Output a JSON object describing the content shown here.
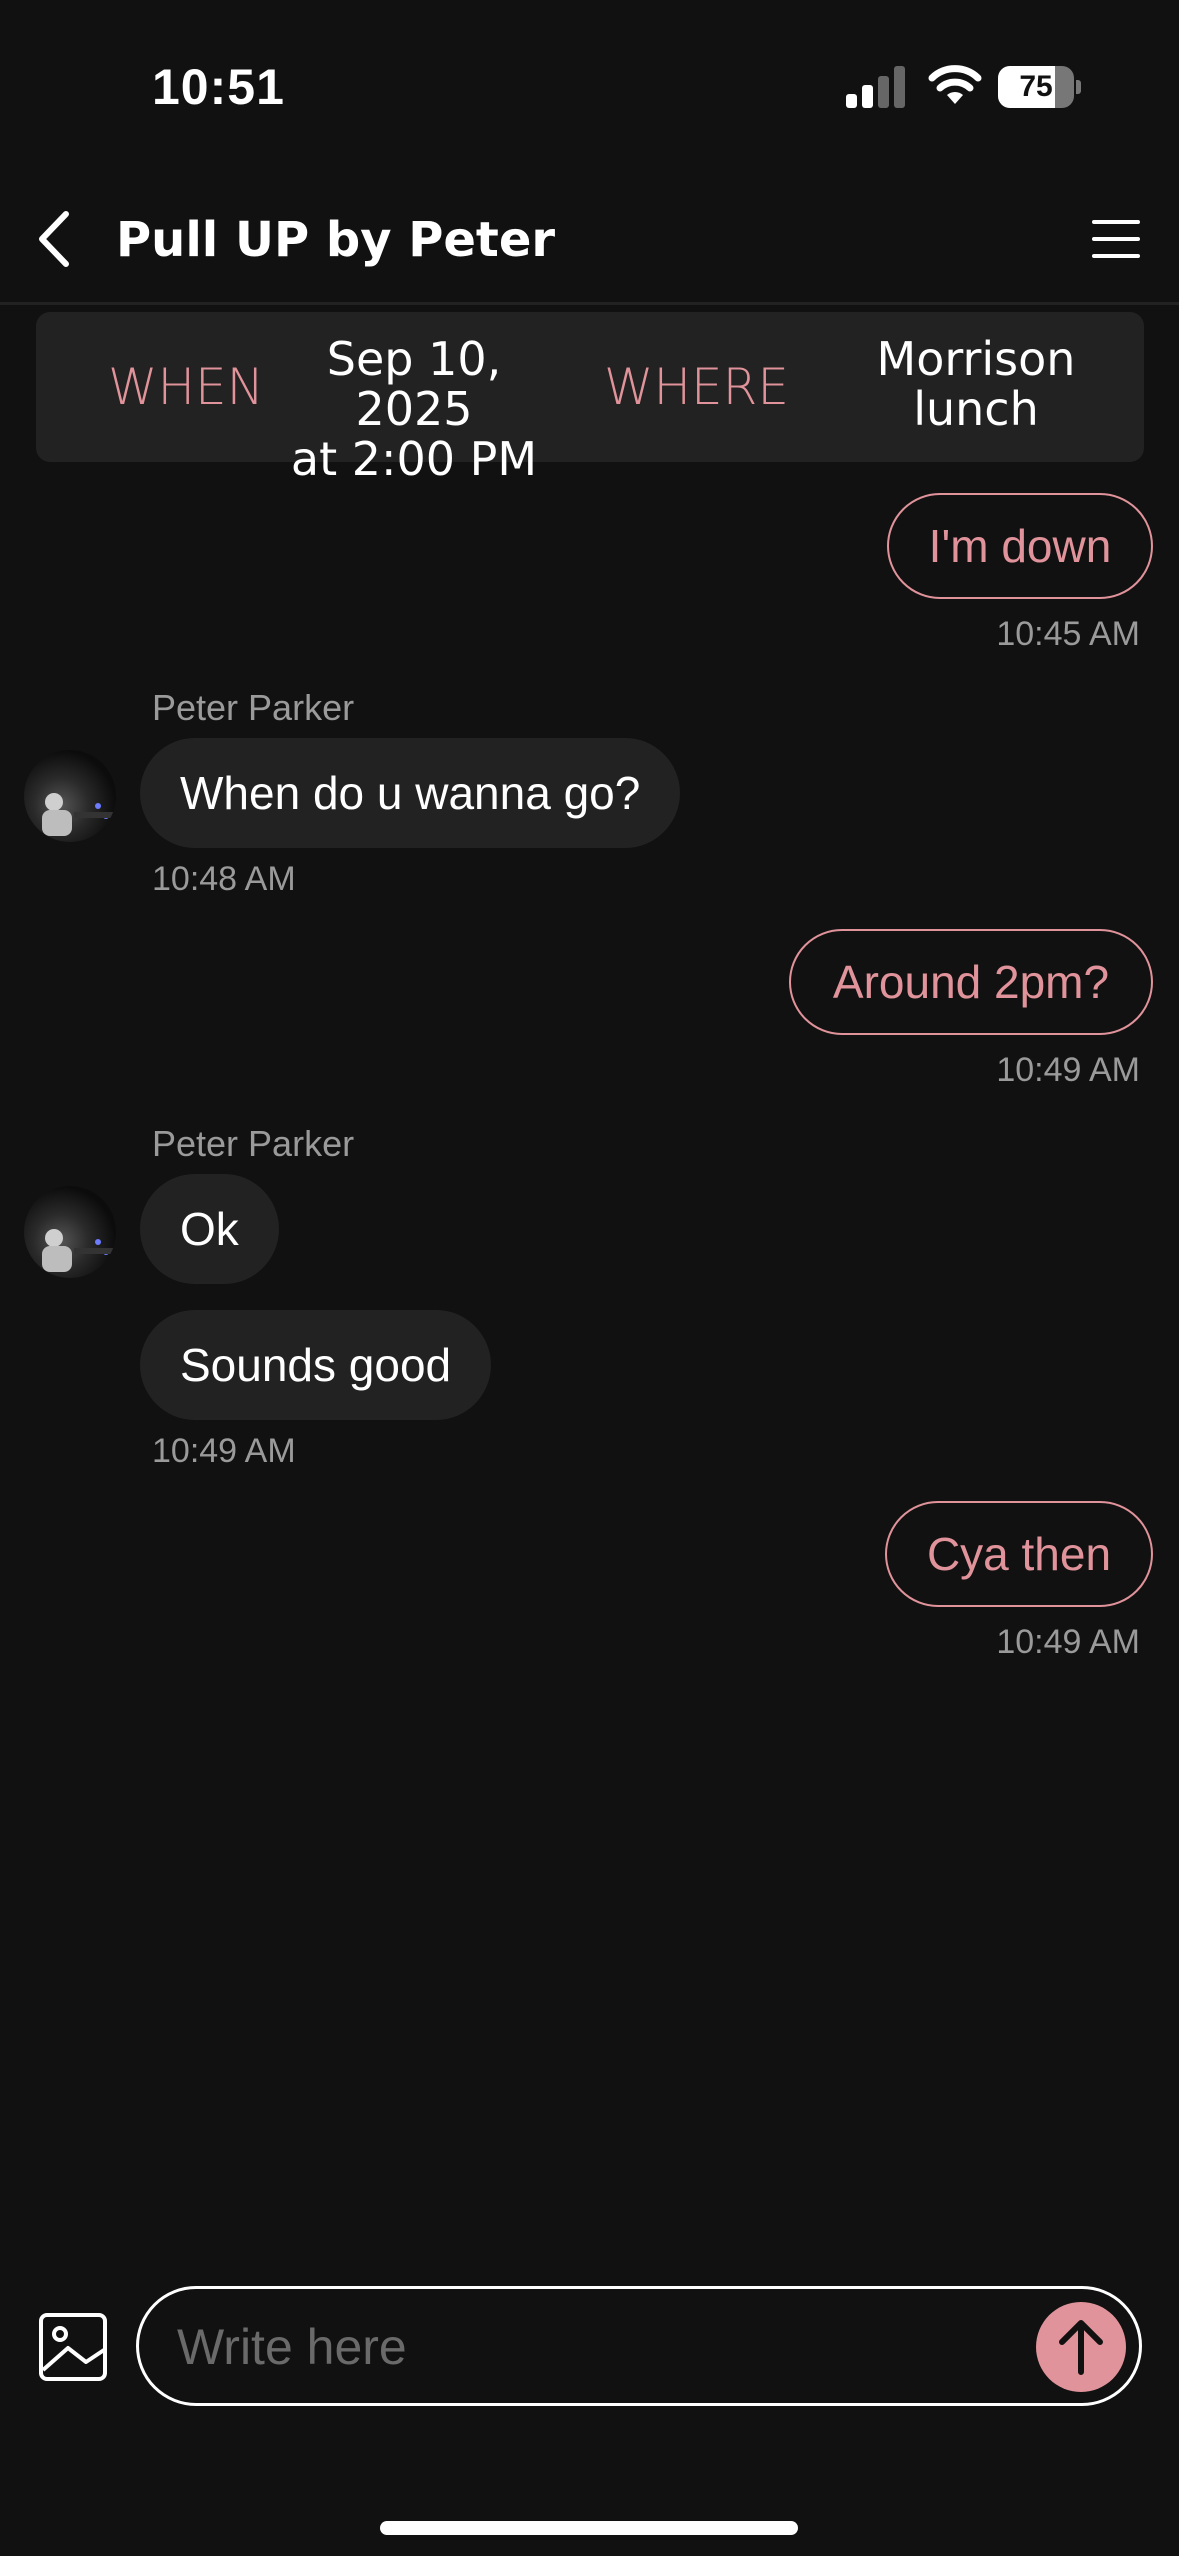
{
  "status_bar": {
    "time": "10:51",
    "battery": "75",
    "battery_level": 0.75
  },
  "header": {
    "title": "Pull UP by Peter"
  },
  "event": {
    "when_label": "WHEN",
    "when_line1": "Sep 10, 2025",
    "when_line2": "at 2:00 PM",
    "where_label": "WHERE",
    "where_line1": "Morrison",
    "where_line2": "lunch"
  },
  "messages": [
    {
      "direction": "out",
      "text": "I'm down",
      "time": "10:45 AM"
    },
    {
      "direction": "in",
      "sender": "Peter Parker",
      "text": "When do u wanna go?",
      "time": "10:48 AM"
    },
    {
      "direction": "out",
      "text": "Around 2pm?",
      "time": "10:49 AM"
    },
    {
      "direction": "in",
      "sender": "Peter Parker",
      "text": "Ok"
    },
    {
      "direction": "in",
      "text": "Sounds good",
      "time": "10:49 AM"
    },
    {
      "direction": "out",
      "text": "Cya then",
      "time": "10:49 AM"
    }
  ],
  "composer": {
    "placeholder": "Write here"
  },
  "colors": {
    "accent": "#e0939a",
    "background": "#111111",
    "bubble_in": "#222222"
  },
  "icons": [
    "back-chevron-icon",
    "hamburger-menu-icon",
    "image-icon",
    "send-arrow-icon",
    "signal-icon",
    "wifi-icon",
    "battery-icon"
  ]
}
